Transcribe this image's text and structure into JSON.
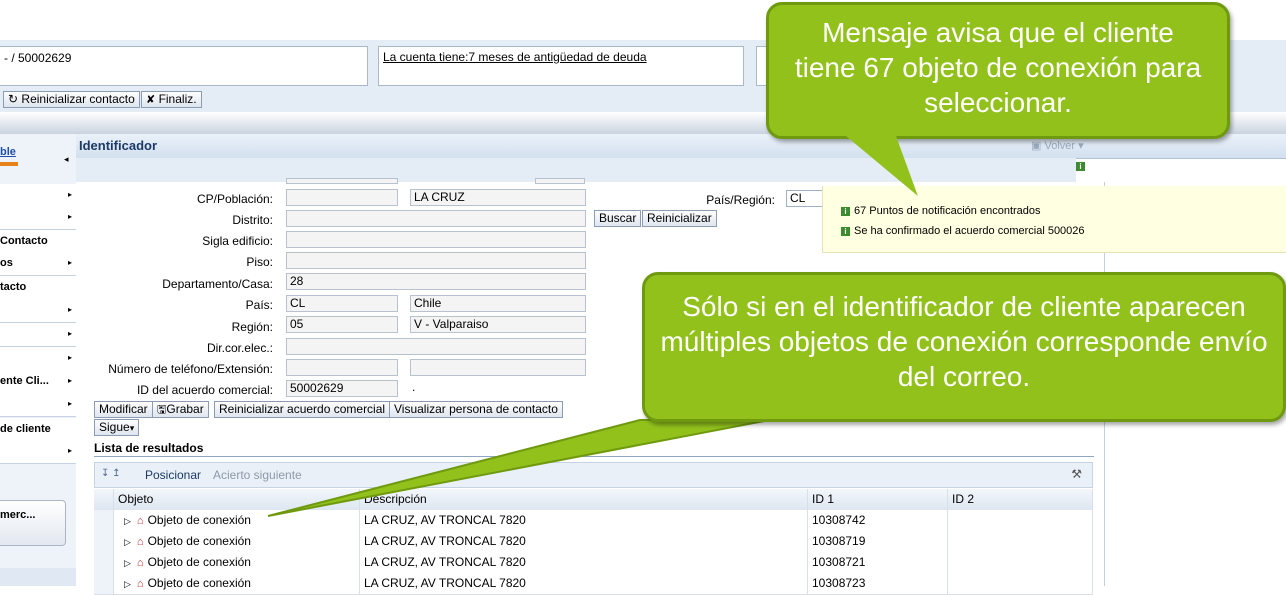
{
  "header": {
    "account_id_text": "- / 50002629",
    "debt_message": "La cuenta tiene:7 meses de antigüedad de deuda",
    "reset_contact_label": "Reinicializar contacto",
    "finalize_label": "Finaliz."
  },
  "nav": {
    "logo_text": "ble",
    "items": [
      {
        "label": "",
        "arrow": "▸"
      },
      {
        "label": "",
        "arrow": "▸"
      },
      {
        "label": "Contacto",
        "arrow": ""
      },
      {
        "label": "os",
        "arrow": "▸"
      },
      {
        "label": "tacto",
        "arrow": ""
      },
      {
        "label": "",
        "arrow": "▸"
      },
      {
        "label": "",
        "arrow": "▸"
      },
      {
        "label": "",
        "arrow": "▸"
      },
      {
        "label": "ente Cli...",
        "arrow": "▸"
      },
      {
        "label": "",
        "arrow": "▸"
      },
      {
        "label": " de cliente",
        "arrow": ""
      },
      {
        "label": "",
        "arrow": "▸"
      }
    ],
    "bottom_button": "merc..."
  },
  "panel": {
    "title": "Identificador",
    "back_label": "Volver"
  },
  "form": {
    "cp_label": "CP/Población:",
    "cp_value": "",
    "city_value": "LA CRUZ",
    "country_region_label": "País/Región:",
    "country_region_value": "CL",
    "district_label": "Distrito:",
    "district_value": "",
    "search_label": "Buscar",
    "reset_label": "Reinicializar",
    "building_label": "Sigla edificio:",
    "building_value": "",
    "floor_label": "Piso:",
    "floor_value": "",
    "apartment_label": "Departamento/Casa:",
    "apartment_value": "28",
    "country_label": "País:",
    "country_code": "CL",
    "country_name": "Chile",
    "region_label": "Región:",
    "region_code": "05",
    "region_name": "V - Valparaiso",
    "email_label": "Dir.cor.elec.:",
    "email_value": "",
    "phone_label": "Número de teléfono/Extensión:",
    "phone_value": "",
    "phone_ext": "",
    "agreement_label": "ID del acuerdo comercial:",
    "agreement_value": "50002629",
    "agreement_dot": "."
  },
  "actions": {
    "modify": "Modificar",
    "save": "Grabar",
    "reset_agreement": "Reinicializar acuerdo comercial",
    "view_contact": "Visualizar persona de contacto",
    "next": "Sigue"
  },
  "messages": [
    "67 Puntos de notificación encontrados",
    "Se ha confirmado el acuerdo comercial 500026"
  ],
  "results": {
    "title": "Lista de resultados",
    "position_label": "Posicionar",
    "next_hit_label": "Acierto siguiente",
    "columns": [
      "Objeto",
      "Descripción",
      "ID 1",
      "ID 2"
    ],
    "rows": [
      {
        "object": "Objeto de conexión",
        "description": "LA CRUZ, AV TRONCAL 7820",
        "id1": "10308742",
        "id2": ""
      },
      {
        "object": "Objeto de conexión",
        "description": "LA CRUZ, AV TRONCAL 7820",
        "id1": "10308719",
        "id2": ""
      },
      {
        "object": "Objeto de conexión",
        "description": "LA CRUZ, AV TRONCAL 7820",
        "id1": "10308721",
        "id2": ""
      },
      {
        "object": "Objeto de conexión",
        "description": "LA CRUZ, AV TRONCAL 7820",
        "id1": "10308723",
        "id2": ""
      }
    ]
  },
  "callouts": {
    "top": "Mensaje avisa que el cliente tiene 67 objeto de conexión para seleccionar.",
    "middle": "Sólo si en el identificador de  cliente aparecen múltiples objetos de conexión corresponde envío del correo."
  },
  "colors": {
    "callout_green": "#92c11c",
    "toolbar_blue": "#e4ecf6",
    "panel_header": "#dbe6f2",
    "message_yellow": "#ffffe1"
  }
}
